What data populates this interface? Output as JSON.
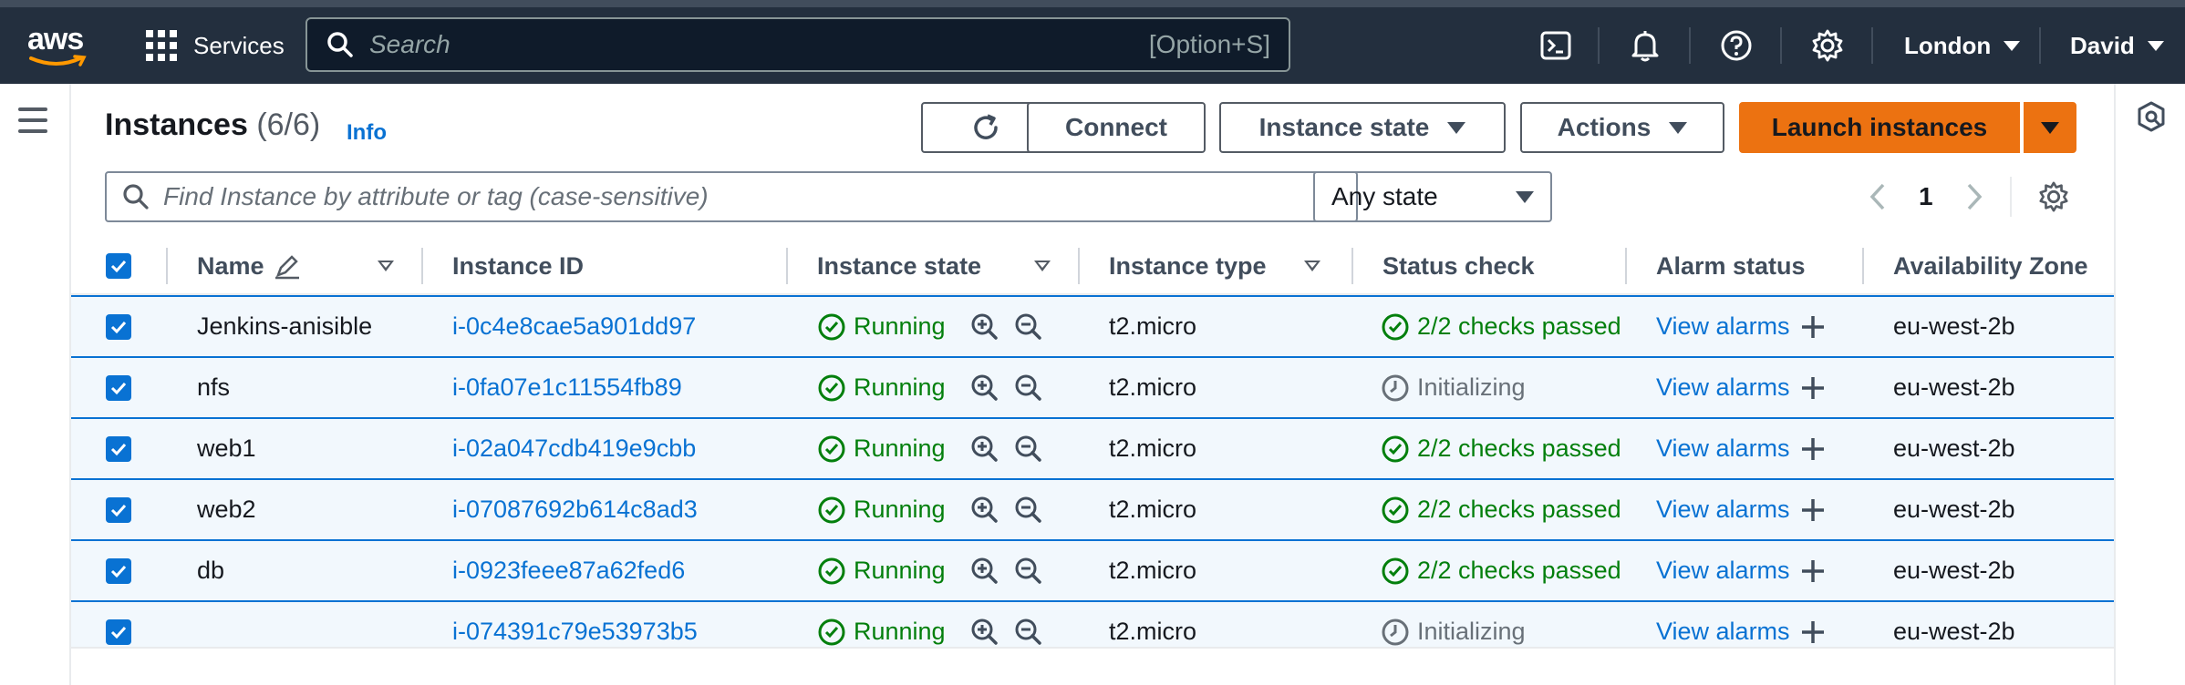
{
  "nav": {
    "logo_text": "aws",
    "services_label": "Services",
    "search_placeholder": "Search",
    "search_shortcut": "[Option+S]",
    "region_label": "London",
    "user_label": "David",
    "icons": [
      "cloudshell-icon",
      "bell-icon",
      "help-icon",
      "settings-icon"
    ]
  },
  "header": {
    "title": "Instances",
    "count": "(6/6)",
    "info_label": "Info",
    "buttons": {
      "connect": "Connect",
      "instance_state": "Instance state",
      "actions": "Actions",
      "launch": "Launch instances"
    }
  },
  "filter": {
    "placeholder": "Find Instance by attribute or tag (case-sensitive)",
    "state_value": "Any state"
  },
  "pagination": {
    "current_page": "1"
  },
  "table": {
    "columns": [
      "Name",
      "Instance ID",
      "Instance state",
      "Instance type",
      "Status check",
      "Alarm status",
      "Availability Zone"
    ],
    "rows": [
      {
        "name": "Jenkins-anisible",
        "id": "i-0c4e8cae5a901dd97",
        "state": "Running",
        "type": "t2.micro",
        "status": "2/2 checks passed",
        "alarm": "View alarms",
        "az": "eu-west-2b"
      },
      {
        "name": "nfs",
        "id": "i-0fa07e1c11554fb89",
        "state": "Running",
        "type": "t2.micro",
        "status": "Initializing",
        "alarm": "View alarms",
        "az": "eu-west-2b"
      },
      {
        "name": "web1",
        "id": "i-02a047cdb419e9cbb",
        "state": "Running",
        "type": "t2.micro",
        "status": "2/2 checks passed",
        "alarm": "View alarms",
        "az": "eu-west-2b"
      },
      {
        "name": "web2",
        "id": "i-07087692b614c8ad3",
        "state": "Running",
        "type": "t2.micro",
        "status": "2/2 checks passed",
        "alarm": "View alarms",
        "az": "eu-west-2b"
      },
      {
        "name": "db",
        "id": "i-0923feee87a62fed6",
        "state": "Running",
        "type": "t2.micro",
        "status": "2/2 checks passed",
        "alarm": "View alarms",
        "az": "eu-west-2b"
      },
      {
        "name": "",
        "id": "i-074391c79e53973b5",
        "state": "Running",
        "type": "t2.micro",
        "status": "Initializing",
        "alarm": "View alarms",
        "az": "eu-west-2b"
      }
    ]
  },
  "colors": {
    "nav_bg": "#232f3e",
    "link": "#0972d3",
    "success": "#037f0c",
    "primary_button": "#ec7211",
    "row_selected_bg": "#f2f8fd"
  }
}
